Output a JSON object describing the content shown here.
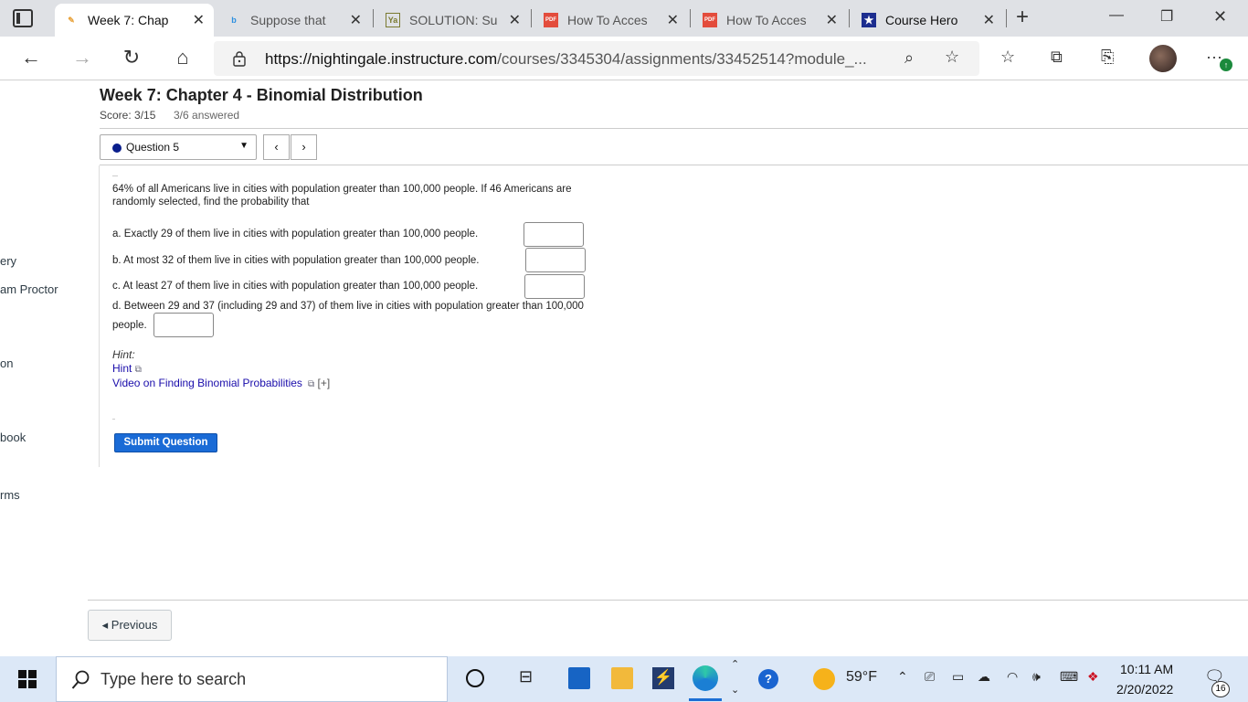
{
  "browser": {
    "tabs": [
      {
        "title": "Week 7: Chap",
        "favicon": "pencil-icon",
        "active": true
      },
      {
        "title": "Suppose that",
        "favicon": "bing-icon",
        "active": false
      },
      {
        "title": "SOLUTION: Su",
        "favicon": "studypool-icon",
        "active": false
      },
      {
        "title": "How To Acces",
        "favicon": "pdf-icon",
        "active": false
      },
      {
        "title": "How To Acces",
        "favicon": "pdf-icon",
        "active": false
      },
      {
        "title": "Course Hero",
        "favicon": "star-icon",
        "active": false
      }
    ],
    "url": "https://nightingale.instructure.com/courses/3345304/assignments/33452514?module_...",
    "url_host": "https://nightingale.instructure.com",
    "url_path": "/courses/3345304/assignments/33452514?module_..."
  },
  "sidebar": {
    "items": [
      "ery",
      "am Proctor",
      "on",
      "book",
      "rms"
    ]
  },
  "assignment": {
    "title": "Week 7: Chapter 4 - Binomial Distribution",
    "score": "Score: 3/15",
    "answered": "3/6 answered"
  },
  "question_nav": {
    "selected": "Question 5",
    "prev_glyph": "‹",
    "next_glyph": "›"
  },
  "question": {
    "intro_line1": "64% of all Americans live in cities with population greater than 100,000 people. If 46 Americans are",
    "intro_line2": "randomly selected, find the probability that",
    "part_a": "a. Exactly 29 of them live in cities with population greater than 100,000 people.",
    "part_b": "b. At most 32 of them live in cities with population greater than 100,000 people.",
    "part_c": "c. At least 27 of them live in cities with population greater than 100,000 people.",
    "part_d_line1": "d. Between 29 and 37 (including 29 and 37) of them live in cities with population greater than 100,000",
    "part_d_line2": "people.",
    "answers": {
      "a": "",
      "b": "",
      "c": "",
      "d": ""
    }
  },
  "hint": {
    "label": "Hint:",
    "link1": "Hint",
    "link2": "Video on Finding Binomial Probabilities",
    "expand": "[+]"
  },
  "submit_label": "Submit Question",
  "previous_label": "◂ Previous",
  "taskbar": {
    "search_placeholder": "Type here to search",
    "weather": "59°F",
    "time": "10:11 AM",
    "date": "2/20/2022",
    "notification_count": "16"
  }
}
